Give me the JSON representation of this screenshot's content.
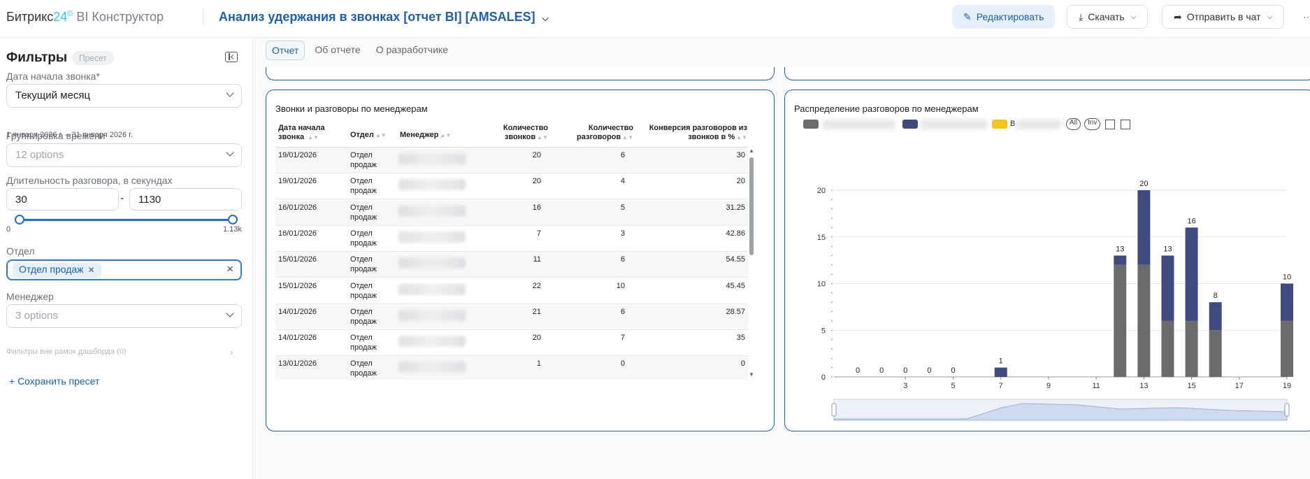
{
  "app": {
    "logo_main": "Битрикс",
    "logo_num": "24",
    "logo_mark": "©",
    "logo_suffix": " BI Конструктор"
  },
  "report": {
    "title": "Анализ удержания в звонках [отчет BI] [AMSALES]"
  },
  "toolbar": {
    "edit_label": "Редактировать",
    "download_label": "Скачать",
    "send_label": "Отправить в чат"
  },
  "sidebar": {
    "title": "Фильтры",
    "preset_badge": "Пресет",
    "date_label": "Дата начала звонка*",
    "date_value": "Текущий месяц",
    "date_hint": "1 января 2026 г. – 31 января 2026 г.",
    "grouping_label": "Группировка времени",
    "grouping_placeholder": "12 options",
    "duration_label": "Длительность разговора, в секундах",
    "duration_min": "30",
    "duration_max": "1130",
    "slider_min_label": "0",
    "slider_max_label": "1.13k",
    "slider_low_fraction": 0.0265,
    "slider_high_fraction": 1.0,
    "department_label": "Отдел",
    "department_tag": "Отдел продаж",
    "manager_label": "Менеджер",
    "manager_placeholder": "3 options",
    "outside_filters": "Фильтры вне рамок дашборда (0)",
    "save_preset": "+ Сохранить пресет"
  },
  "tabs": [
    {
      "label": "Отчет",
      "active": true
    },
    {
      "label": "Об отчете",
      "active": false
    },
    {
      "label": "О разработчике",
      "active": false
    }
  ],
  "table_card": {
    "title": "Звонки и разговоры по менеджерам",
    "columns": [
      "Дата начала звонка",
      "Отдел",
      "Менеджер",
      "Количество звонков",
      "Количество разговоров",
      "Конверсия разговоров из звонков в %"
    ],
    "rows": [
      {
        "date": "19/01/2026",
        "dept": "Отдел продаж",
        "calls": "20",
        "talks": "6",
        "conv": "30"
      },
      {
        "date": "19/01/2026",
        "dept": "Отдел продаж",
        "calls": "20",
        "talks": "4",
        "conv": "20"
      },
      {
        "date": "16/01/2026",
        "dept": "Отдел продаж",
        "calls": "16",
        "talks": "5",
        "conv": "31.25"
      },
      {
        "date": "16/01/2026",
        "dept": "Отдел продаж",
        "calls": "7",
        "talks": "3",
        "conv": "42.86"
      },
      {
        "date": "15/01/2026",
        "dept": "Отдел продаж",
        "calls": "11",
        "talks": "6",
        "conv": "54.55"
      },
      {
        "date": "15/01/2026",
        "dept": "Отдел продаж",
        "calls": "22",
        "talks": "10",
        "conv": "45.45"
      },
      {
        "date": "14/01/2026",
        "dept": "Отдел продаж",
        "calls": "21",
        "talks": "6",
        "conv": "28.57"
      },
      {
        "date": "14/01/2026",
        "dept": "Отдел продаж",
        "calls": "20",
        "talks": "7",
        "conv": "35"
      },
      {
        "date": "13/01/2026",
        "dept": "Отдел продаж",
        "calls": "1",
        "talks": "0",
        "conv": "0"
      }
    ]
  },
  "chart_card": {
    "title": "Распределение разговоров по менеджерам",
    "chip_all": "All",
    "chip_inv": "Inv",
    "legend_b3_text": "В"
  },
  "colors": {
    "accent": "#1f5fa8",
    "series_gray": "#6b6b6b",
    "series_navy": "#3f4a7f",
    "series_yellow": "#f5c518"
  },
  "chart_data": {
    "type": "bar",
    "stacked": true,
    "x": [
      1,
      2,
      3,
      4,
      5,
      7,
      12,
      13,
      14,
      15,
      16,
      19
    ],
    "x_ticks": [
      3,
      5,
      7,
      9,
      11,
      13,
      15,
      17,
      19
    ],
    "xlim": [
      0,
      19
    ],
    "y_ticks": [
      0,
      5,
      10,
      15,
      20
    ],
    "ylim": [
      0,
      20
    ],
    "series": [
      {
        "values": [
          0,
          0,
          0,
          0,
          0,
          0,
          12,
          12,
          6,
          6,
          5,
          6
        ]
      },
      {
        "values": [
          0,
          0,
          0,
          0,
          0,
          1,
          1,
          8,
          7,
          10,
          3,
          4
        ]
      }
    ],
    "totals": [
      0,
      0,
      0,
      0,
      0,
      1,
      13,
      20,
      13,
      16,
      8,
      10
    ],
    "total_labels": [
      "0",
      "0",
      "0",
      "0",
      "0",
      "1",
      "13",
      "20",
      "13",
      "16",
      "8",
      "10"
    ],
    "grid": true,
    "legend_position": "top-left",
    "data_zoom": true
  }
}
